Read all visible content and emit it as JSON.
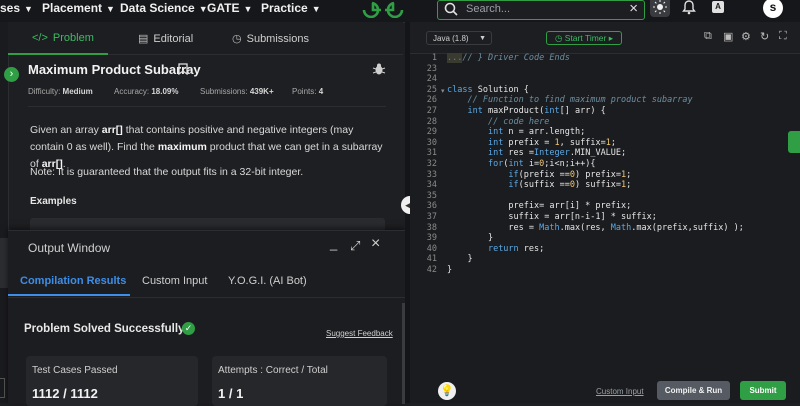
{
  "nav": {
    "items": [
      {
        "label": "ses"
      },
      {
        "label": "Placement"
      },
      {
        "label": "Data Science"
      },
      {
        "label": "GATE"
      },
      {
        "label": "Practice"
      }
    ],
    "search_placeholder": "Search...",
    "avatar_letter": "s"
  },
  "problem_tabs": {
    "problem": "Problem",
    "editorial": "Editorial",
    "submissions": "Submissions"
  },
  "problem": {
    "title": "Maximum Product Subarray",
    "meta": {
      "difficulty_label": "Difficulty:",
      "difficulty": "Medium",
      "accuracy_label": "Accuracy:",
      "accuracy": "18.09%",
      "submissions_label": "Submissions:",
      "submissions": "439K+",
      "points_label": "Points:",
      "points": "4"
    },
    "desc_1": "Given an array ",
    "desc_arr": "arr[]",
    "desc_2": " that contains positive and negative integers (may contain 0 as well). Find the ",
    "desc_max": "maximum",
    "desc_3": " product that we can get in a subarray of ",
    "desc_arr2": "arr[]",
    "desc_4": ".",
    "note": "Note: It is guaranteed that the output fits in a 32-bit integer.",
    "examples_heading": "Examples"
  },
  "output_window": {
    "title": "Output Window",
    "tabs": {
      "compile": "Compilation Results",
      "custom": "Custom Input",
      "yogi": "Y.O.G.I. (AI Bot)"
    },
    "status": "Problem Solved Successfully",
    "feedback": "Suggest Feedback",
    "tests_label": "Test Cases Passed",
    "tests_value": "1112 / 1112",
    "attempts_label": "Attempts : Correct / Total",
    "attempts_value": "1 / 1"
  },
  "editor": {
    "language": "Java (1.8)",
    "timer": "Start Timer",
    "custom_input": "Custom Input",
    "run": "Compile & Run",
    "submit": "Submit",
    "code": [
      {
        "n": "1",
        "t": "// } Driver Code Ends"
      },
      {
        "n": "23",
        "t": ""
      },
      {
        "n": "24",
        "t": ""
      },
      {
        "n": "25",
        "t": "class Solution {"
      },
      {
        "n": "26",
        "t": "    // Function to find maximum product subarray"
      },
      {
        "n": "27",
        "t": "    int maxProduct(int[] arr) {"
      },
      {
        "n": "28",
        "t": "        // code here"
      },
      {
        "n": "29",
        "t": "        int n = arr.length;"
      },
      {
        "n": "30",
        "t": "        int prefix = 1, suffix=1;"
      },
      {
        "n": "31",
        "t": "        int res =Integer.MIN_VALUE;"
      },
      {
        "n": "32",
        "t": "        for(int i=0;i<n;i++){"
      },
      {
        "n": "33",
        "t": "            if(prefix ==0) prefix=1;"
      },
      {
        "n": "34",
        "t": "            if(suffix ==0) suffix=1;"
      },
      {
        "n": "35",
        "t": ""
      },
      {
        "n": "36",
        "t": "            prefix= arr[i] * prefix;"
      },
      {
        "n": "37",
        "t": "            suffix = arr[n-i-1] * suffix;"
      },
      {
        "n": "38",
        "t": "            res = Math.max(res, Math.max(prefix,suffix) );"
      },
      {
        "n": "39",
        "t": "        }"
      },
      {
        "n": "40",
        "t": "        return res;"
      },
      {
        "n": "41",
        "t": "    }"
      },
      {
        "n": "42",
        "t": "}"
      }
    ]
  },
  "colors": {
    "accent_green": "#2f9e44",
    "accent_blue": "#3d8ee8",
    "background": "#1e1f22"
  }
}
